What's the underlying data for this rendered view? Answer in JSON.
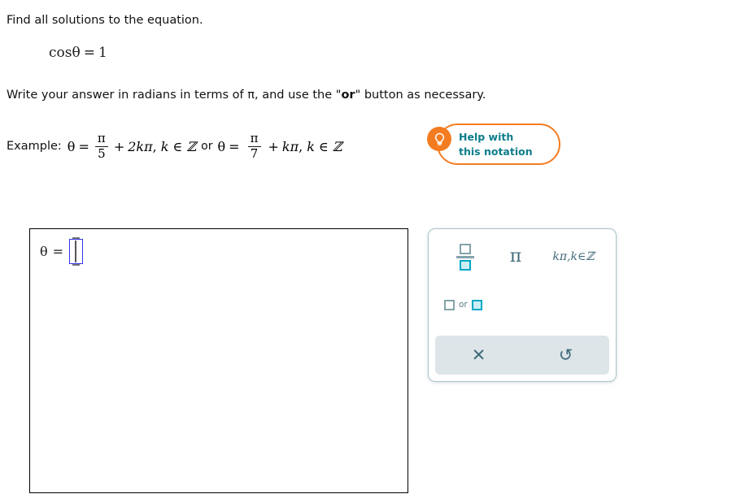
{
  "prompt": {
    "line1": "Find all solutions to the equation.",
    "line2_before": "Write your answer in radians in terms of π, and use the ",
    "line2_quote_open": "\"",
    "line2_bold": "or",
    "line2_quote_close": "\"",
    "line2_after": " button as necessary."
  },
  "equation": {
    "function": "cos",
    "variable": "θ",
    "equals": "=",
    "value": "1"
  },
  "example": {
    "label": "Example:",
    "first": {
      "variable": "θ",
      "equals": "=",
      "numerator": "π",
      "denominator": "5",
      "plus": "+",
      "term": "2kπ",
      "comma": ",",
      "membership": "k ∈ ℤ"
    },
    "connector": "or",
    "second": {
      "variable": "θ",
      "equals": "=",
      "numerator": "π",
      "denominator": "7",
      "plus": "+",
      "term": "kπ",
      "comma": ",",
      "membership": "k ∈ ℤ"
    }
  },
  "help_button": {
    "icon": "lightbulb-icon",
    "line1": "Help with",
    "line2": "this notation",
    "accent_color": "#f47c20",
    "text_color": "#0d7d8c"
  },
  "answer": {
    "variable": "θ",
    "equals": "=",
    "input_value": "",
    "caret_visible": true
  },
  "palette": {
    "buttons": [
      {
        "name": "fraction",
        "label": "□/□"
      },
      {
        "name": "pi",
        "label": "π"
      },
      {
        "name": "k-pi-k-in-Z",
        "label": "kπ,k∈ℤ"
      }
    ],
    "or_button": {
      "name": "or",
      "word": "or",
      "left_box": "□",
      "right_box": "□"
    },
    "actions": [
      {
        "name": "clear",
        "glyph": "✕"
      },
      {
        "name": "undo",
        "glyph": "↺"
      }
    ],
    "border_color": "#a9c4c9",
    "icon_color": "#3f6a78",
    "highlight_color": "#00a8c6",
    "actionbar_color": "#dde5e9"
  }
}
